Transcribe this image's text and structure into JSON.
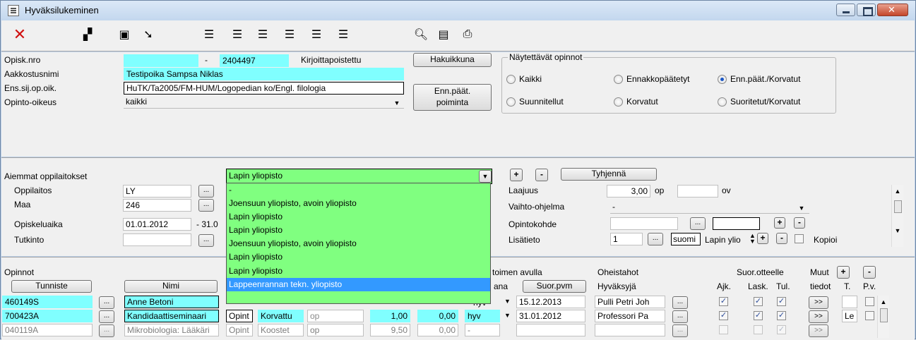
{
  "window": {
    "title": "Hyväksilukeminen"
  },
  "toolbar": {
    "icons": [
      "delete-icon",
      "copy-icon",
      "save-icon",
      "export-icon",
      "add-row-icon",
      "remove-row-icon",
      "first-record-icon",
      "prev-record-icon",
      "next-record-icon",
      "last-record-icon",
      "search-icon",
      "document-icon",
      "print-icon"
    ]
  },
  "student": {
    "opisk_nro_label": "Opisk.nro",
    "opisk_nro_prefix": "",
    "opisk_nro_sep": "-",
    "opisk_nro": "2404497",
    "status": "Kirjoittapoistettu",
    "aakkostusnimi_label": "Aakkostusnimi",
    "aakkostusnimi": "Testipoika Sampsa Niklas",
    "ens_label": "Ens.sij.op.oik.",
    "ens": "HuTK/Ta2005/FM-HUM/Logopedian ko/Engl. filologia",
    "opinto_oikeus_label": "Opinto-oikeus",
    "opinto_oikeus": "kaikki",
    "hakuikkuna_btn": "Hakuikkuna",
    "enn_poiminta_btn_1": "Enn.päät.",
    "enn_poiminta_btn_2": "poiminta"
  },
  "nayta": {
    "caption": "Näytettävät opinnot",
    "options": [
      "Kaikki",
      "Ennakkopäätetyt",
      "Enn.päät./Korvatut",
      "Suunnitellut",
      "Korvatut",
      "Suoritetut/Korvatut"
    ],
    "selected": "Enn.päät./Korvatut"
  },
  "aiemmat": {
    "caption": "Aiemmat oppilaitokset",
    "combo_value": "Lapin yliopisto",
    "oppilaitos_label": "Oppilaitos",
    "oppilaitos": "LY",
    "maa_label": "Maa",
    "maa": "246",
    "opiskeluaika_label": "Opiskeluaika",
    "opiskeluaika_start": "01.01.2012",
    "opiskeluaika_sep": "- 31.0",
    "tutkinto_label": "Tutkinto",
    "plus": "+",
    "minus": "-",
    "tyhjenna_btn": "Tyhjennä",
    "laajuus_label": "Laajuus",
    "laajuus": "3,00",
    "laajuus_unit": "op",
    "ov_unit": "ov",
    "vaihto_label": "Vaihto-ohjelma",
    "vaihto": "-",
    "opintokohde_label": "Opintokohde",
    "lisatieto_label": "Lisätieto",
    "lisatieto_num": "1",
    "lang": "suomi",
    "lapin_short": "Lapin ylio",
    "kopioi_label": "Kopioi"
  },
  "dropdown": {
    "items": [
      "-",
      "Joensuun yliopisto, avoin yliopisto",
      "Lapin yliopisto",
      "Lapin yliopisto",
      "Joensuun yliopisto, avoin yliopisto",
      "Lapin yliopisto",
      "Lapin yliopisto",
      "Lappeenrannan tekn. yliopisto"
    ],
    "selected_index": 7
  },
  "opinnot": {
    "caption": "Opinnot",
    "tunniste_btn": "Tunniste",
    "nimi_btn": "Nimi",
    "toimen_label": "toimen avulla",
    "ana_label": "ana",
    "suor_pvm_btn": "Suor.pvm",
    "oheistahot_label": "Oheistahot",
    "hyvaksyja_label": "Hyväksyjä",
    "suor_otteelle_label": "Suor.otteelle",
    "muut_label": "Muut",
    "tiedot_label": "tiedot",
    "ajk_label": "Ajk.",
    "lask_label": "Lask.",
    "tul_label": "Tul.",
    "t_label": "T.",
    "pv_label": "P.v.",
    "rows": [
      {
        "tunniste": "460149S",
        "nimi": "Anne Betoni",
        "c1": "",
        "c2": "",
        "c3": "",
        "laajuus": "",
        "arvo": "",
        "arv": "hyv",
        "pvm": "15.12.2013",
        "hyvaksyja": "Pulli Petri Joh",
        "t": ""
      },
      {
        "tunniste": "700423A",
        "nimi": "Kandidaattiseminaari",
        "c1": "Opint",
        "c2": "Korvattu",
        "c3": "op",
        "laajuus": "1,00",
        "arvo": "0,00",
        "arv": "hyv",
        "pvm": "31.01.2012",
        "hyvaksyja": "Professori Pa",
        "t": "Le"
      },
      {
        "tunniste": "040119A",
        "nimi": "Mikrobiologia: Lääkäri",
        "c1": "Opint",
        "c2": "Koostet",
        "c3": "op",
        "laajuus": "9,50",
        "arvo": "0,00",
        "arv": "-",
        "pvm": "",
        "hyvaksyja": "",
        "t": ""
      }
    ],
    "more_btn": ">>"
  },
  "colors": {
    "cyan": "#80ffff",
    "green": "#80ff80",
    "selection": "#3399ff"
  }
}
